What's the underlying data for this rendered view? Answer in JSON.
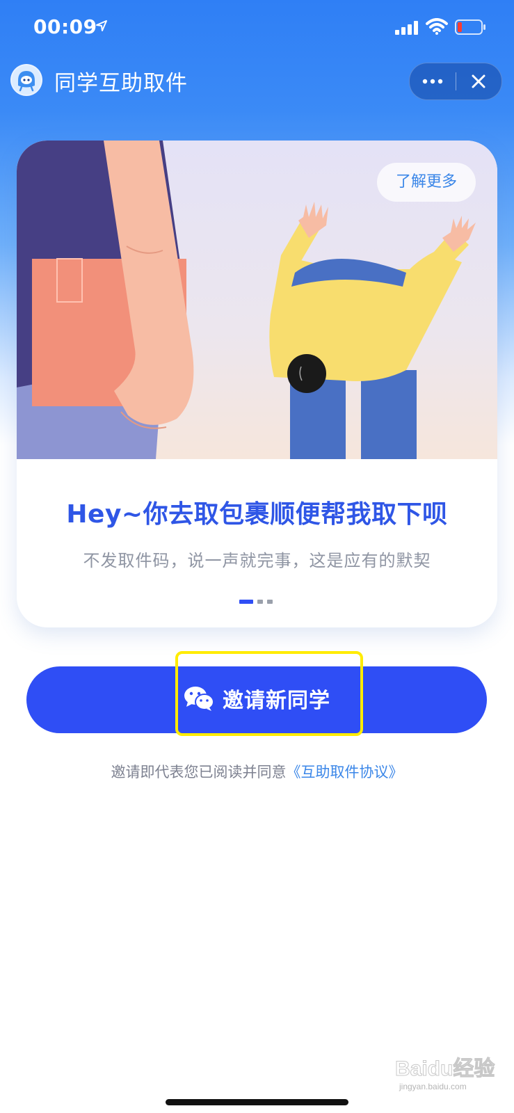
{
  "status_bar": {
    "time": "00:09"
  },
  "nav": {
    "title": "同学互助取件"
  },
  "card": {
    "learn_more": "了解更多",
    "headline": "Hey~你去取包裹顺便帮我取下呗",
    "subline": "不发取件码，说一声就完事，这是应有的默契",
    "pagination": {
      "total": 3,
      "active": 1
    }
  },
  "invite": {
    "label": "邀请新同学"
  },
  "agreement": {
    "prefix": "邀请即代表您已阅读并同意",
    "link": "《互助取件协议》"
  },
  "watermark": {
    "text": "Baidu经验",
    "subtext": "jingyan.baidu.com"
  },
  "colors": {
    "primary": "#2f4ef5",
    "headline": "#2f56e6",
    "link": "#3a86e8",
    "highlight": "#ffec00",
    "battery_low": "#ff3b30"
  }
}
